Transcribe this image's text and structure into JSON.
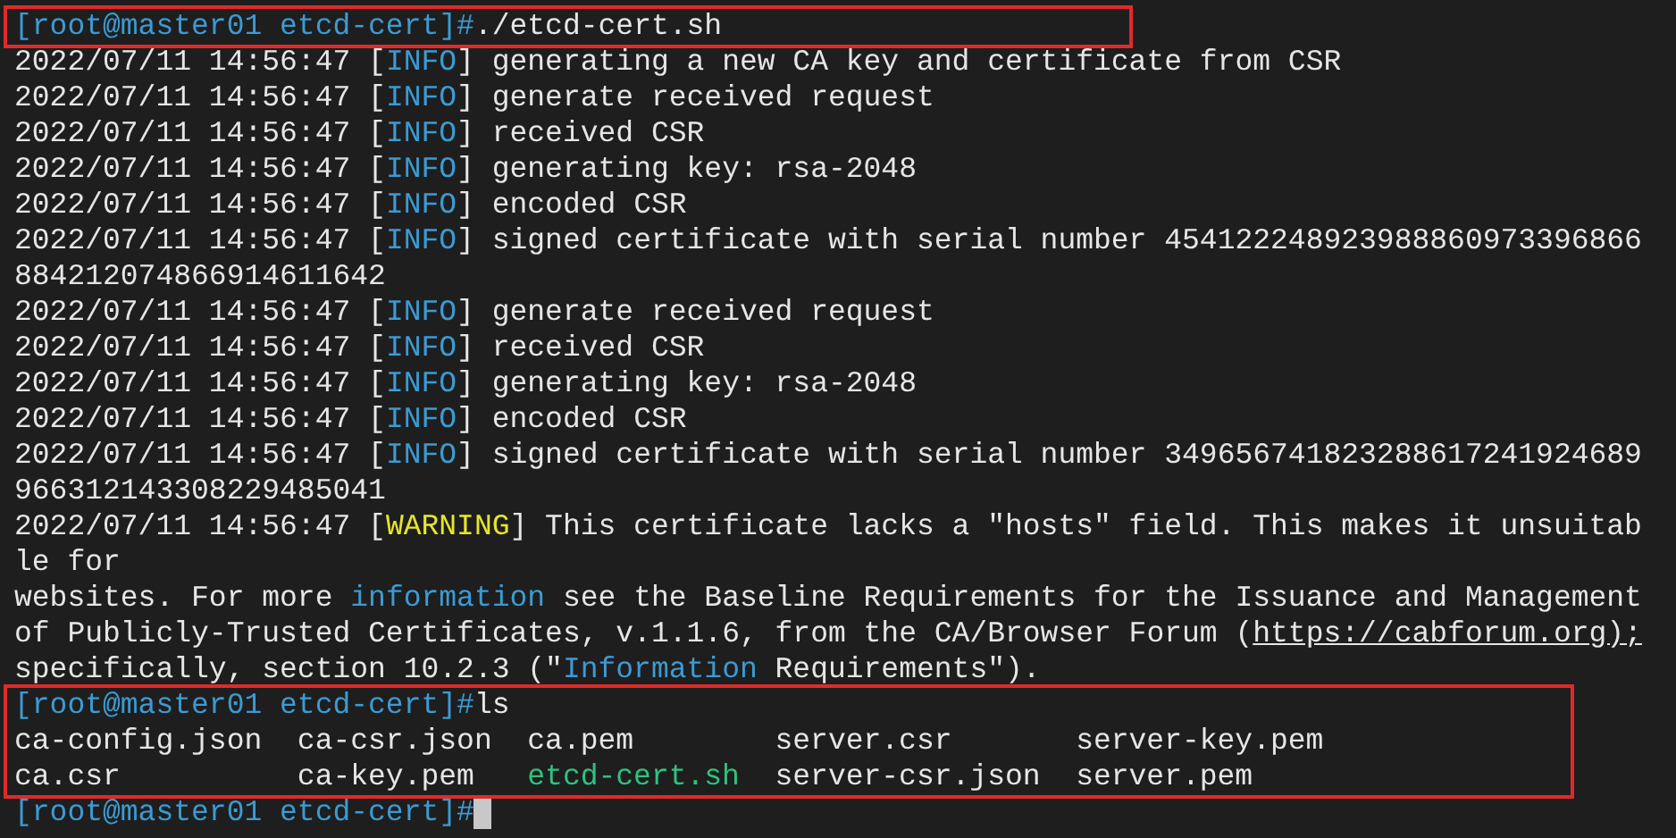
{
  "terminal": {
    "cursor_visible": true,
    "blocks": [
      {
        "highlighted": true,
        "lines": [
          {
            "kind": "text",
            "spans": [
              {
                "kind": "prompt",
                "text": "[root@master01 etcd-cert]#"
              },
              {
                "kind": "text",
                "text": "./etcd-cert.sh"
              }
            ]
          }
        ]
      },
      {
        "highlighted": false,
        "lines": [
          {
            "kind": "text",
            "spans": [
              {
                "kind": "text",
                "text": "2022/07/11 14:56:47 ["
              },
              {
                "kind": "info",
                "text": "INFO"
              },
              {
                "kind": "text",
                "text": "] generating a new CA key and certificate from CSR"
              }
            ]
          },
          {
            "kind": "text",
            "spans": [
              {
                "kind": "text",
                "text": "2022/07/11 14:56:47 ["
              },
              {
                "kind": "info",
                "text": "INFO"
              },
              {
                "kind": "text",
                "text": "] generate received request"
              }
            ]
          },
          {
            "kind": "text",
            "spans": [
              {
                "kind": "text",
                "text": "2022/07/11 14:56:47 ["
              },
              {
                "kind": "info",
                "text": "INFO"
              },
              {
                "kind": "text",
                "text": "] received CSR"
              }
            ]
          },
          {
            "kind": "text",
            "spans": [
              {
                "kind": "text",
                "text": "2022/07/11 14:56:47 ["
              },
              {
                "kind": "info",
                "text": "INFO"
              },
              {
                "kind": "text",
                "text": "] generating key: rsa-2048"
              }
            ]
          },
          {
            "kind": "text",
            "spans": [
              {
                "kind": "text",
                "text": "2022/07/11 14:56:47 ["
              },
              {
                "kind": "info",
                "text": "INFO"
              },
              {
                "kind": "text",
                "text": "] encoded CSR"
              }
            ]
          },
          {
            "kind": "text",
            "spans": [
              {
                "kind": "text",
                "text": "2022/07/11 14:56:47 ["
              },
              {
                "kind": "info",
                "text": "INFO"
              },
              {
                "kind": "text",
                "text": "] signed certificate with serial number 454122248923988860973396866"
              }
            ]
          },
          {
            "kind": "text",
            "spans": [
              {
                "kind": "text",
                "text": "884212074866914611642"
              }
            ]
          },
          {
            "kind": "text",
            "spans": [
              {
                "kind": "text",
                "text": "2022/07/11 14:56:47 ["
              },
              {
                "kind": "info",
                "text": "INFO"
              },
              {
                "kind": "text",
                "text": "] generate received request"
              }
            ]
          },
          {
            "kind": "text",
            "spans": [
              {
                "kind": "text",
                "text": "2022/07/11 14:56:47 ["
              },
              {
                "kind": "info",
                "text": "INFO"
              },
              {
                "kind": "text",
                "text": "] received CSR"
              }
            ]
          },
          {
            "kind": "text",
            "spans": [
              {
                "kind": "text",
                "text": "2022/07/11 14:56:47 ["
              },
              {
                "kind": "info",
                "text": "INFO"
              },
              {
                "kind": "text",
                "text": "] generating key: rsa-2048"
              }
            ]
          },
          {
            "kind": "text",
            "spans": [
              {
                "kind": "text",
                "text": "2022/07/11 14:56:47 ["
              },
              {
                "kind": "info",
                "text": "INFO"
              },
              {
                "kind": "text",
                "text": "] encoded CSR"
              }
            ]
          },
          {
            "kind": "text",
            "spans": [
              {
                "kind": "text",
                "text": "2022/07/11 14:56:47 ["
              },
              {
                "kind": "info",
                "text": "INFO"
              },
              {
                "kind": "text",
                "text": "] signed certificate with serial number 349656741823288617241924689"
              }
            ]
          },
          {
            "kind": "text",
            "spans": [
              {
                "kind": "text",
                "text": "966312143308229485041"
              }
            ]
          },
          {
            "kind": "text",
            "spans": [
              {
                "kind": "text",
                "text": "2022/07/11 14:56:47 ["
              },
              {
                "kind": "warning",
                "text": "WARNING"
              },
              {
                "kind": "text",
                "text": "] This certificate lacks a \"hosts\" field. This makes it unsuitab"
              }
            ]
          },
          {
            "kind": "text",
            "spans": [
              {
                "kind": "text",
                "text": "le for"
              }
            ]
          },
          {
            "kind": "text",
            "spans": [
              {
                "kind": "text",
                "text": "websites. For more "
              },
              {
                "kind": "keyword",
                "text": "information"
              },
              {
                "kind": "text",
                "text": " see the Baseline Requirements for the Issuance and Management"
              }
            ]
          },
          {
            "kind": "text",
            "spans": [
              {
                "kind": "text",
                "text": "of Publicly-Trusted Certificates, v.1.1.6, from the CA/Browser Forum ("
              },
              {
                "kind": "url",
                "text": "https://cabforum.org);"
              }
            ]
          },
          {
            "kind": "text",
            "spans": [
              {
                "kind": "text",
                "text": "specifically, section 10.2.3 (\""
              },
              {
                "kind": "keyword",
                "text": "Information"
              },
              {
                "kind": "text",
                "text": " Requirements\")."
              }
            ]
          }
        ]
      },
      {
        "highlighted": true,
        "lines": [
          {
            "kind": "text",
            "spans": [
              {
                "kind": "prompt",
                "text": "[root@master01 etcd-cert]#"
              },
              {
                "kind": "text",
                "text": "ls"
              }
            ]
          },
          {
            "kind": "listing",
            "files": [
              {
                "kind": "file",
                "text": "ca-config.json"
              },
              {
                "kind": "file",
                "text": "ca-csr.json"
              },
              {
                "kind": "file",
                "text": "ca.pem"
              },
              {
                "kind": "file",
                "text": "server.csr"
              },
              {
                "kind": "file",
                "text": "server-key.pem"
              }
            ]
          },
          {
            "kind": "listing",
            "files": [
              {
                "kind": "file",
                "text": "ca.csr"
              },
              {
                "kind": "file",
                "text": "ca-key.pem"
              },
              {
                "kind": "exec",
                "text": "etcd-cert.sh"
              },
              {
                "kind": "file",
                "text": "server-csr.json"
              },
              {
                "kind": "file",
                "text": "server.pem"
              }
            ]
          }
        ]
      },
      {
        "highlighted": false,
        "lines": [
          {
            "kind": "text",
            "spans": [
              {
                "kind": "prompt",
                "text": "[root@master01 etcd-cert]#"
              }
            ]
          }
        ]
      }
    ]
  }
}
